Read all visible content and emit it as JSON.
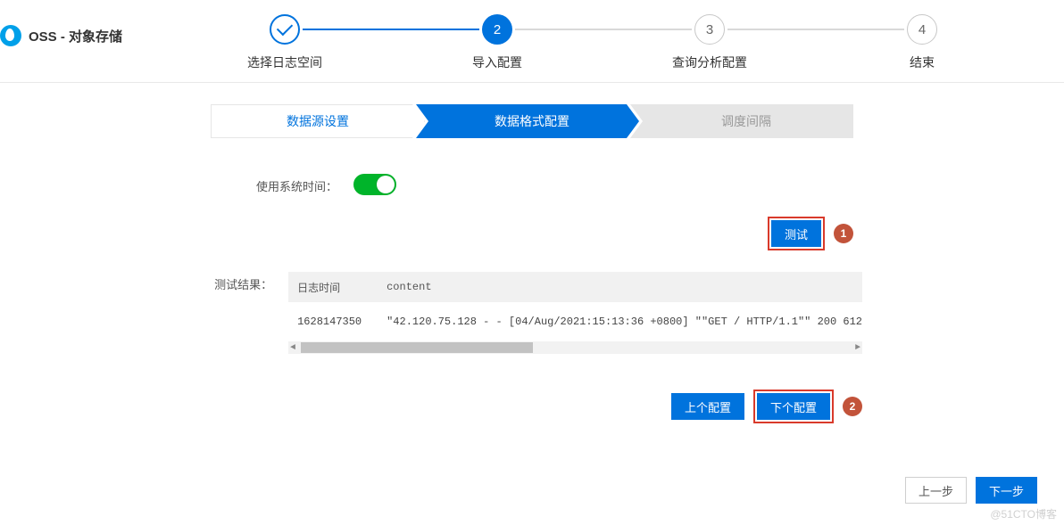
{
  "header": {
    "title": "OSS - 对象存储"
  },
  "wizard": {
    "steps": [
      {
        "num": "✓",
        "label": "选择日志空间",
        "state": "done"
      },
      {
        "num": "2",
        "label": "导入配置",
        "state": "active"
      },
      {
        "num": "3",
        "label": "查询分析配置",
        "state": "pending"
      },
      {
        "num": "4",
        "label": "结束",
        "state": "pending"
      }
    ]
  },
  "subtabs": {
    "items": [
      {
        "label": "数据源设置",
        "kind": "link"
      },
      {
        "label": "数据格式配置",
        "kind": "active"
      },
      {
        "label": "调度间隔",
        "kind": "disabled"
      }
    ]
  },
  "form": {
    "system_time_label": "使用系统时间：",
    "system_time_on": true,
    "test_button": "测试",
    "result_label": "测试结果：",
    "table": {
      "col_time": "日志时间",
      "col_content": "content",
      "rows": [
        {
          "time": "1628147350",
          "content": "\"42.120.75.128 - - [04/Aug/2021:15:13:36 +0800] \"\"GET / HTTP/1.1\"\" 200 612"
        }
      ]
    },
    "prev_config": "上个配置",
    "next_config": "下个配置"
  },
  "callouts": {
    "one": "1",
    "two": "2"
  },
  "footer": {
    "prev": "上一步",
    "next": "下一步"
  },
  "watermark": "@51CTO博客"
}
